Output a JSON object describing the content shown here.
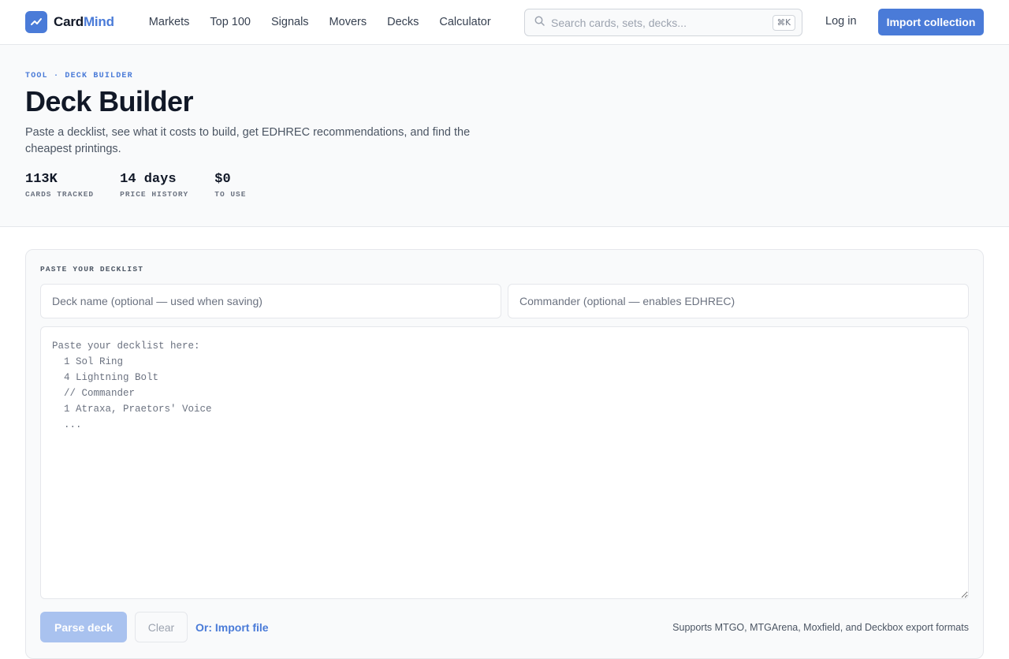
{
  "brand": {
    "name_part1": "Card",
    "name_part2": "Mind",
    "logo_icon": "trend-chart-icon",
    "accent": "#4a7bd8"
  },
  "nav": {
    "items": [
      "Markets",
      "Top 100",
      "Signals",
      "Movers",
      "Decks",
      "Calculator"
    ]
  },
  "search": {
    "placeholder": "Search cards, sets, decks...",
    "shortcut": "⌘K",
    "icon": "search-icon"
  },
  "header": {
    "login_label": "Log in",
    "import_label": "Import collection"
  },
  "hero": {
    "eyebrow": "Tool · Deck Builder",
    "title": "Deck Builder",
    "subtitle": "Paste a decklist, see what it costs to build, get EDHREC recommendations, and find the cheapest printings.",
    "stats": [
      {
        "value": "113K",
        "label": "Cards tracked"
      },
      {
        "value": "14 days",
        "label": "Price history"
      },
      {
        "value": "$0",
        "label": "To use"
      }
    ]
  },
  "builder": {
    "section_label": "Paste your decklist",
    "deck_name_placeholder": "Deck name (optional — used when saving)",
    "commander_placeholder": "Commander (optional — enables EDHREC)",
    "decklist_placeholder": "Paste your decklist here:\n  1 Sol Ring\n  4 Lightning Bolt\n  // Commander\n  1 Atraxa, Praetors' Voice\n  ...",
    "parse_label": "Parse deck",
    "clear_label": "Clear",
    "import_file_label": "Or: Import file",
    "formats_note": "Supports MTGO, MTGArena, Moxfield, and Deckbox export formats"
  }
}
